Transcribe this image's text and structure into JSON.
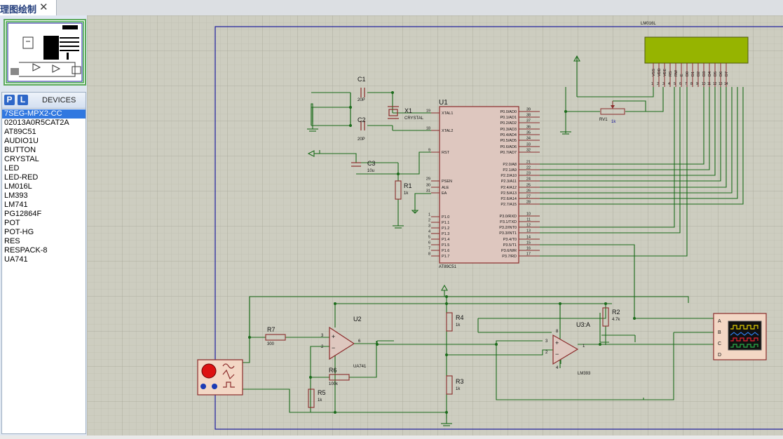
{
  "tab": {
    "title": "理图绘制",
    "close": "✕"
  },
  "devices": {
    "btn_p": "P",
    "btn_l": "L",
    "title": "DEVICES",
    "items": [
      "7SEG-MPX2-CC",
      "02013A0R5CAT2A",
      "AT89C51",
      "AUDIO1U",
      "BUTTON",
      "CRYSTAL",
      "LED",
      "LED-RED",
      "LM016L",
      "LM393",
      "LM741",
      "PG12864F",
      "POT",
      "POT-HG",
      "RES",
      "RESPACK-8",
      "UA741"
    ],
    "selected": "7SEG-MPX2-CC"
  },
  "schematic": {
    "lcd": {
      "name": "LM016L",
      "pins": [
        "VSS",
        "VDD",
        "VEE",
        "RS",
        "RW",
        "E",
        "D0",
        "D1",
        "D2",
        "D3",
        "D4",
        "D5",
        "D6",
        "D7"
      ],
      "nums": [
        "1",
        "2",
        "3",
        "4",
        "5",
        "6",
        "7",
        "8",
        "9",
        "10",
        "11",
        "12",
        "13",
        "14"
      ]
    },
    "u1": {
      "ref": "U1",
      "part": "AT89C51",
      "left_pins": [
        {
          "num": "19",
          "name": "XTAL1"
        },
        {
          "num": "18",
          "name": "XTAL2"
        },
        {
          "num": "9",
          "name": "RST"
        },
        {
          "num": "29",
          "name": "PSEN"
        },
        {
          "num": "30",
          "name": "ALE"
        },
        {
          "num": "31",
          "name": "EA"
        },
        {
          "num": "1",
          "name": "P1.0"
        },
        {
          "num": "2",
          "name": "P1.1"
        },
        {
          "num": "3",
          "name": "P1.2"
        },
        {
          "num": "4",
          "name": "P1.3"
        },
        {
          "num": "5",
          "name": "P1.4"
        },
        {
          "num": "6",
          "name": "P1.5"
        },
        {
          "num": "7",
          "name": "P1.6"
        },
        {
          "num": "8",
          "name": "P1.7"
        }
      ],
      "right_pins": [
        {
          "num": "39",
          "name": "P0.0/AD0"
        },
        {
          "num": "38",
          "name": "P0.1/AD1"
        },
        {
          "num": "37",
          "name": "P0.2/AD2"
        },
        {
          "num": "36",
          "name": "P0.3/AD3"
        },
        {
          "num": "35",
          "name": "P0.4/AD4"
        },
        {
          "num": "34",
          "name": "P0.5/AD5"
        },
        {
          "num": "33",
          "name": "P0.6/AD6"
        },
        {
          "num": "32",
          "name": "P0.7/AD7"
        },
        {
          "num": "21",
          "name": "P2.0/A8"
        },
        {
          "num": "22",
          "name": "P2.1/A9"
        },
        {
          "num": "23",
          "name": "P2.2/A10"
        },
        {
          "num": "24",
          "name": "P2.3/A11"
        },
        {
          "num": "25",
          "name": "P2.4/A12"
        },
        {
          "num": "26",
          "name": "P2.5/A13"
        },
        {
          "num": "27",
          "name": "P2.6/A14"
        },
        {
          "num": "28",
          "name": "P2.7/A15"
        },
        {
          "num": "10",
          "name": "P3.0/RXD"
        },
        {
          "num": "11",
          "name": "P3.1/TXD"
        },
        {
          "num": "12",
          "name": "P3.2/INT0"
        },
        {
          "num": "13",
          "name": "P3.3/INT1"
        },
        {
          "num": "14",
          "name": "P3.4/T0"
        },
        {
          "num": "15",
          "name": "P3.5/T1"
        },
        {
          "num": "16",
          "name": "P3.6/WR"
        },
        {
          "num": "17",
          "name": "P3.7/RD"
        }
      ]
    },
    "c1": {
      "ref": "C1",
      "val": "20P"
    },
    "c2": {
      "ref": "C2",
      "val": "20P"
    },
    "c3": {
      "ref": "C3",
      "val": "10u"
    },
    "x1": {
      "ref": "X1",
      "val": "CRYSTAL"
    },
    "r1": {
      "ref": "R1",
      "val": "1k"
    },
    "rv1": {
      "ref": "RV1",
      "val": "1k"
    },
    "r2": {
      "ref": "R2",
      "val": "4.7k"
    },
    "r4": {
      "ref": "R4",
      "val": "1k"
    },
    "r3": {
      "ref": "R3",
      "val": "1k"
    },
    "r5": {
      "ref": "R5",
      "val": "1k"
    },
    "r6": {
      "ref": "R6",
      "val": "100k"
    },
    "r7": {
      "ref": "R7",
      "val": "300"
    },
    "u2": {
      "ref": "U2",
      "part": "UA741",
      "pin_in_plus": "3",
      "pin_in_minus": "2",
      "pin_out": "6"
    },
    "u3": {
      "ref": "U3:A",
      "part": "LM393",
      "pin_in_plus": "3",
      "pin_in_minus": "2",
      "pin_out": "1",
      "pin_v": "8",
      "pin_g": "4"
    },
    "scope": {
      "channels": [
        "A",
        "B",
        "C",
        "D"
      ]
    },
    "colors": {
      "grid_bg": "#cdcdc0",
      "wire": "#1a6b1a",
      "component": "#8b2b2b",
      "border": "#1a1a9c",
      "lcd_screen": "#96b400",
      "signal_gen": "#f3d7c5"
    }
  }
}
